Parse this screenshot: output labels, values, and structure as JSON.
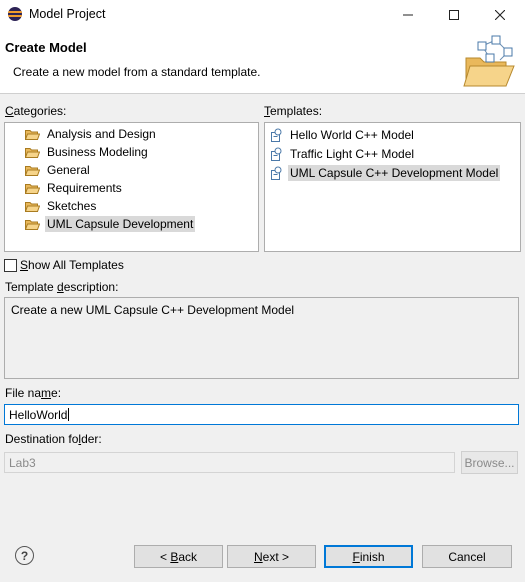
{
  "window": {
    "title": "Model Project",
    "controls": {
      "minimize": "─",
      "maximize": "☐",
      "close": "✕"
    }
  },
  "header": {
    "title": "Create Model",
    "description": "Create a new model from a standard template."
  },
  "categories": {
    "label_mnemonic": "C",
    "label_rest": "ategories:",
    "items": [
      {
        "label": "Analysis and Design",
        "selected": false
      },
      {
        "label": "Business Modeling",
        "selected": false
      },
      {
        "label": "General",
        "selected": false
      },
      {
        "label": "Requirements",
        "selected": false
      },
      {
        "label": "Sketches",
        "selected": false
      },
      {
        "label": "UML Capsule Development",
        "selected": true
      }
    ]
  },
  "templates": {
    "label_mnemonic": "T",
    "label_rest": "emplates:",
    "items": [
      {
        "label": "Hello World C++ Model",
        "selected": false
      },
      {
        "label": "Traffic Light C++ Model",
        "selected": false
      },
      {
        "label": "UML Capsule C++ Development Model",
        "selected": true
      }
    ]
  },
  "show_all": {
    "label_mnemonic": "S",
    "label_rest": "how All Templates",
    "checked": false
  },
  "template_description": {
    "label_pre": "Template ",
    "label_mnemonic": "d",
    "label_rest": "escription:",
    "text": "Create a new UML Capsule C++ Development Model"
  },
  "file_name": {
    "label_pre": "File na",
    "label_mnemonic": "m",
    "label_rest": "e:",
    "value": "HelloWorld"
  },
  "destination": {
    "label_pre": "Destination fo",
    "label_mnemonic": "l",
    "label_rest": "der:",
    "value": "Lab3",
    "browse_label": "Browse..."
  },
  "buttons": {
    "help_glyph": "?",
    "back": {
      "pre": "< ",
      "mnemonic": "B",
      "rest": "ack"
    },
    "next": {
      "mnemonic": "N",
      "rest": "ext >"
    },
    "finish": {
      "mnemonic": "F",
      "rest": "inish"
    },
    "cancel": "Cancel"
  },
  "colors": {
    "selection": "#d9d9d9",
    "default_button_border": "#0078d7",
    "folder_fill": "#f4c46a",
    "disabled_text": "#8a8a8a"
  }
}
